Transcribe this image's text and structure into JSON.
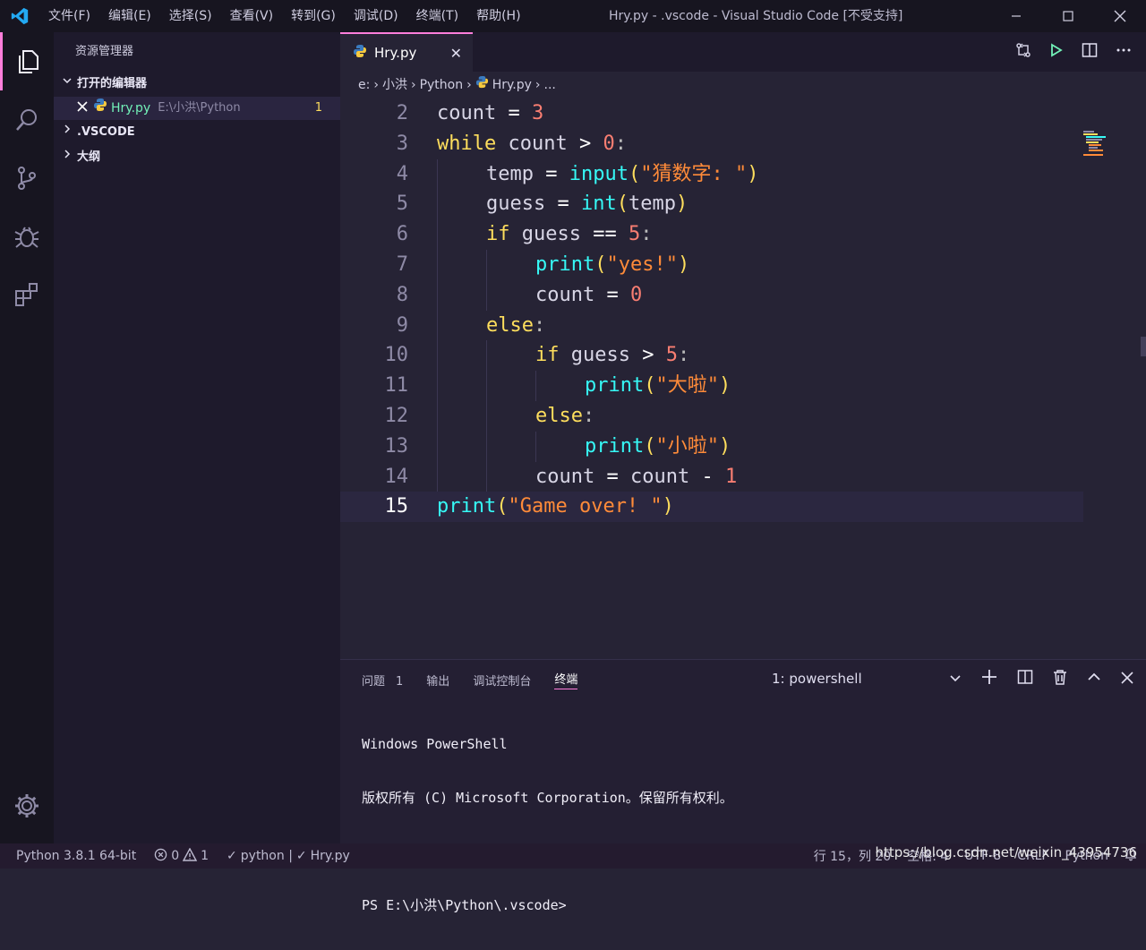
{
  "menu": [
    "文件(F)",
    "编辑(E)",
    "选择(S)",
    "查看(V)",
    "转到(G)",
    "调试(D)",
    "终端(T)",
    "帮助(H)"
  ],
  "window_title": "Hry.py - .vscode - Visual Studio Code [不受支持]",
  "sidebar": {
    "title": "资源管理器",
    "open_editors": "打开的编辑器",
    "file_name": "Hry.py",
    "file_path": "E:\\小洪\\Python",
    "file_count": "1",
    "vscode_section": ".VSCODE",
    "outline_section": "大纲"
  },
  "tab": {
    "label": "Hry.py"
  },
  "breadcrumb": [
    "e:",
    "小洪",
    "Python",
    "Hry.py",
    "..."
  ],
  "code_lines": [
    {
      "n": "2",
      "indent": 0
    },
    {
      "n": "3",
      "indent": 0
    },
    {
      "n": "4",
      "indent": 1
    },
    {
      "n": "5",
      "indent": 1
    },
    {
      "n": "6",
      "indent": 1
    },
    {
      "n": "7",
      "indent": 2
    },
    {
      "n": "8",
      "indent": 2
    },
    {
      "n": "9",
      "indent": 1
    },
    {
      "n": "10",
      "indent": 2
    },
    {
      "n": "11",
      "indent": 3
    },
    {
      "n": "12",
      "indent": 2
    },
    {
      "n": "13",
      "indent": 3
    },
    {
      "n": "14",
      "indent": 2
    },
    {
      "n": "15",
      "indent": 0
    }
  ],
  "code_tokens": [
    [
      [
        "var",
        "count"
      ],
      [
        "op",
        " = "
      ],
      [
        "num",
        "3"
      ]
    ],
    [
      [
        "kw",
        "while"
      ],
      [
        "var",
        " count "
      ],
      [
        "op",
        ">"
      ],
      [
        "var",
        " "
      ],
      [
        "num",
        "0"
      ],
      [
        "punc",
        ":"
      ]
    ],
    [
      [
        "var",
        "temp"
      ],
      [
        "op",
        " = "
      ],
      [
        "fn",
        "input"
      ],
      [
        "br",
        "("
      ],
      [
        "str",
        "\"猜数字: \""
      ],
      [
        "br",
        ")"
      ]
    ],
    [
      [
        "var",
        "guess"
      ],
      [
        "op",
        " = "
      ],
      [
        "fn",
        "int"
      ],
      [
        "br",
        "("
      ],
      [
        "var",
        "temp"
      ],
      [
        "br",
        ")"
      ]
    ],
    [
      [
        "kw",
        "if"
      ],
      [
        "var",
        " guess "
      ],
      [
        "op",
        "=="
      ],
      [
        "var",
        " "
      ],
      [
        "num",
        "5"
      ],
      [
        "punc",
        ":"
      ]
    ],
    [
      [
        "fn",
        "print"
      ],
      [
        "br",
        "("
      ],
      [
        "str",
        "\"yes!\""
      ],
      [
        "br",
        ")"
      ]
    ],
    [
      [
        "var",
        "count"
      ],
      [
        "op",
        " = "
      ],
      [
        "num",
        "0"
      ]
    ],
    [
      [
        "kw",
        "else"
      ],
      [
        "punc",
        ":"
      ]
    ],
    [
      [
        "kw",
        "if"
      ],
      [
        "var",
        " guess "
      ],
      [
        "op",
        ">"
      ],
      [
        "var",
        " "
      ],
      [
        "num",
        "5"
      ],
      [
        "punc",
        ":"
      ]
    ],
    [
      [
        "fn",
        "print"
      ],
      [
        "br",
        "("
      ],
      [
        "str",
        "\"大啦\""
      ],
      [
        "br",
        ")"
      ]
    ],
    [
      [
        "kw",
        "else"
      ],
      [
        "punc",
        ":"
      ]
    ],
    [
      [
        "fn",
        "print"
      ],
      [
        "br",
        "("
      ],
      [
        "str",
        "\"小啦\""
      ],
      [
        "br",
        ")"
      ]
    ],
    [
      [
        "var",
        "count"
      ],
      [
        "op",
        " = "
      ],
      [
        "var",
        "count "
      ],
      [
        "op",
        "-"
      ],
      [
        "var",
        " "
      ],
      [
        "num",
        "1"
      ]
    ],
    [
      [
        "fn",
        "print"
      ],
      [
        "br",
        "("
      ],
      [
        "str",
        "\"Game over! \""
      ],
      [
        "br",
        ")"
      ]
    ]
  ],
  "panel": {
    "tabs": [
      "问题",
      "输出",
      "调试控制台",
      "终端"
    ],
    "problems_badge": "1",
    "terminal_select": "1: powershell",
    "terminal_lines": [
      "Windows PowerShell",
      "版权所有 (C) Microsoft Corporation。保留所有权利。",
      "",
      "PS E:\\小洪\\Python\\.vscode>"
    ]
  },
  "status": {
    "interpreter": "Python 3.8.1 64-bit",
    "errors": "0",
    "warnings": "1",
    "linter": "python | ",
    "file": "Hry.py",
    "position": "行 15，列 20",
    "spaces": "空格: 4",
    "encoding": "UTF-8",
    "eol": "CRLF",
    "language": "Python"
  },
  "watermark": "https://blog.csdn.net/weixin_43954736",
  "colors": {
    "accent": "#ff7edb",
    "keyword": "#fede5d",
    "function": "#36f9f6",
    "number": "#f97e72",
    "string": "#ff8b39"
  }
}
